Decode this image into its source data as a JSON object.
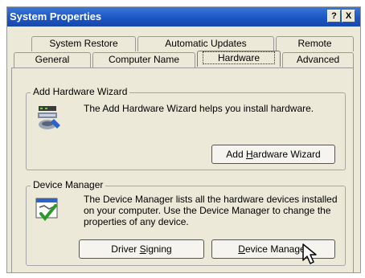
{
  "window": {
    "title": "System Properties"
  },
  "titlebar": {
    "help_label": "?",
    "close_label": "X"
  },
  "tabs_back": [
    "System Restore",
    "Automatic Updates",
    "Remote"
  ],
  "tabs_front": [
    "General",
    "Computer Name",
    "Hardware",
    "Advanced"
  ],
  "active_tab": "Hardware",
  "add_hw": {
    "title": "Add Hardware Wizard",
    "desc": "The Add Hardware Wizard helps you install hardware.",
    "button_pre": "Add ",
    "button_key": "H",
    "button_post": "ardware Wizard"
  },
  "device_manager": {
    "title": "Device Manager",
    "desc_line1": "The Device Manager lists all the hardware devices installed",
    "desc_line2": "on your computer. Use the Device Manager to change the",
    "desc_line3": "properties of any device.",
    "driver_pre": "Driver ",
    "driver_key": "S",
    "driver_post": "igning",
    "dm_key": "D",
    "dm_post": "evice Manager"
  },
  "icons": [
    "add-hardware-wizard-icon",
    "device-manager-icon",
    "mouse-cursor-icon"
  ]
}
